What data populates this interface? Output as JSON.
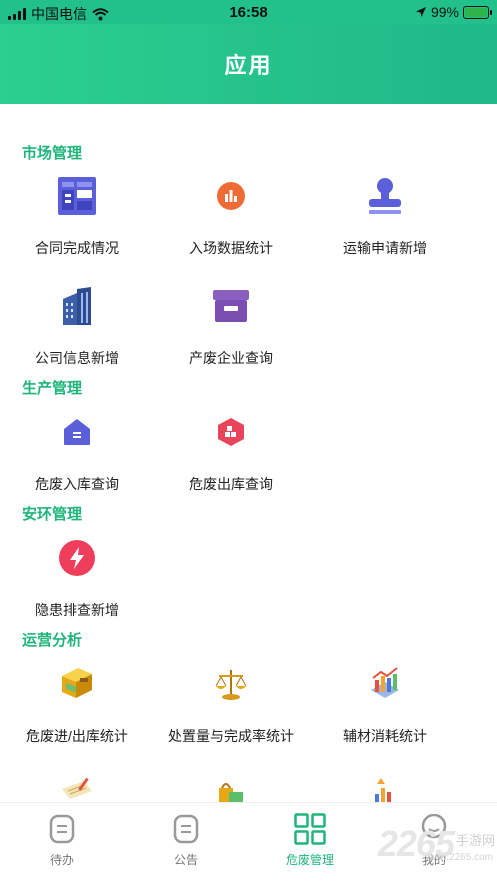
{
  "status_bar": {
    "carrier": "中国电信",
    "time": "16:58",
    "battery": "99%"
  },
  "header": {
    "title": "应用"
  },
  "sections": [
    {
      "title": "市场管理",
      "items": [
        {
          "label": "合同完成情况",
          "icon": "contract-grid-icon"
        },
        {
          "label": "入场数据统计",
          "icon": "bar-stats-icon"
        },
        {
          "label": "运输申请新增",
          "icon": "stamp-icon"
        },
        {
          "label": "公司信息新增",
          "icon": "building-icon"
        },
        {
          "label": "产废企业查询",
          "icon": "archive-box-icon"
        }
      ]
    },
    {
      "title": "生产管理",
      "items": [
        {
          "label": "危废入库查询",
          "icon": "warehouse-in-icon"
        },
        {
          "label": "危废出库查询",
          "icon": "warehouse-out-icon"
        }
      ]
    },
    {
      "title": "安环管理",
      "items": [
        {
          "label": "隐患排查新增",
          "icon": "lightning-icon"
        }
      ]
    },
    {
      "title": "运营分析",
      "items": [
        {
          "label": "危废进/出库统计",
          "icon": "cash-box-icon"
        },
        {
          "label": "处置量与完成率统计",
          "icon": "scale-icon"
        },
        {
          "label": "辅材消耗统计",
          "icon": "chart-3d-icon"
        },
        {
          "label": "",
          "icon": "notebook-icon"
        },
        {
          "label": "",
          "icon": "shopping-bags-icon"
        },
        {
          "label": "",
          "icon": "growth-chart-icon"
        }
      ]
    }
  ],
  "tabbar": [
    {
      "label": "待办",
      "icon": "todo-icon",
      "active": false
    },
    {
      "label": "公告",
      "icon": "notice-icon",
      "active": false
    },
    {
      "label": "危废管理",
      "icon": "grid-apps-icon",
      "active": true
    },
    {
      "label": "我的",
      "icon": "profile-icon",
      "active": false
    }
  ],
  "watermark": {
    "number": "2265",
    "text": "手游网",
    "url": "www.2265.com"
  },
  "colors": {
    "accent": "#1fb57a",
    "header_start": "#2ccf8f",
    "header_end": "#1fb889"
  }
}
